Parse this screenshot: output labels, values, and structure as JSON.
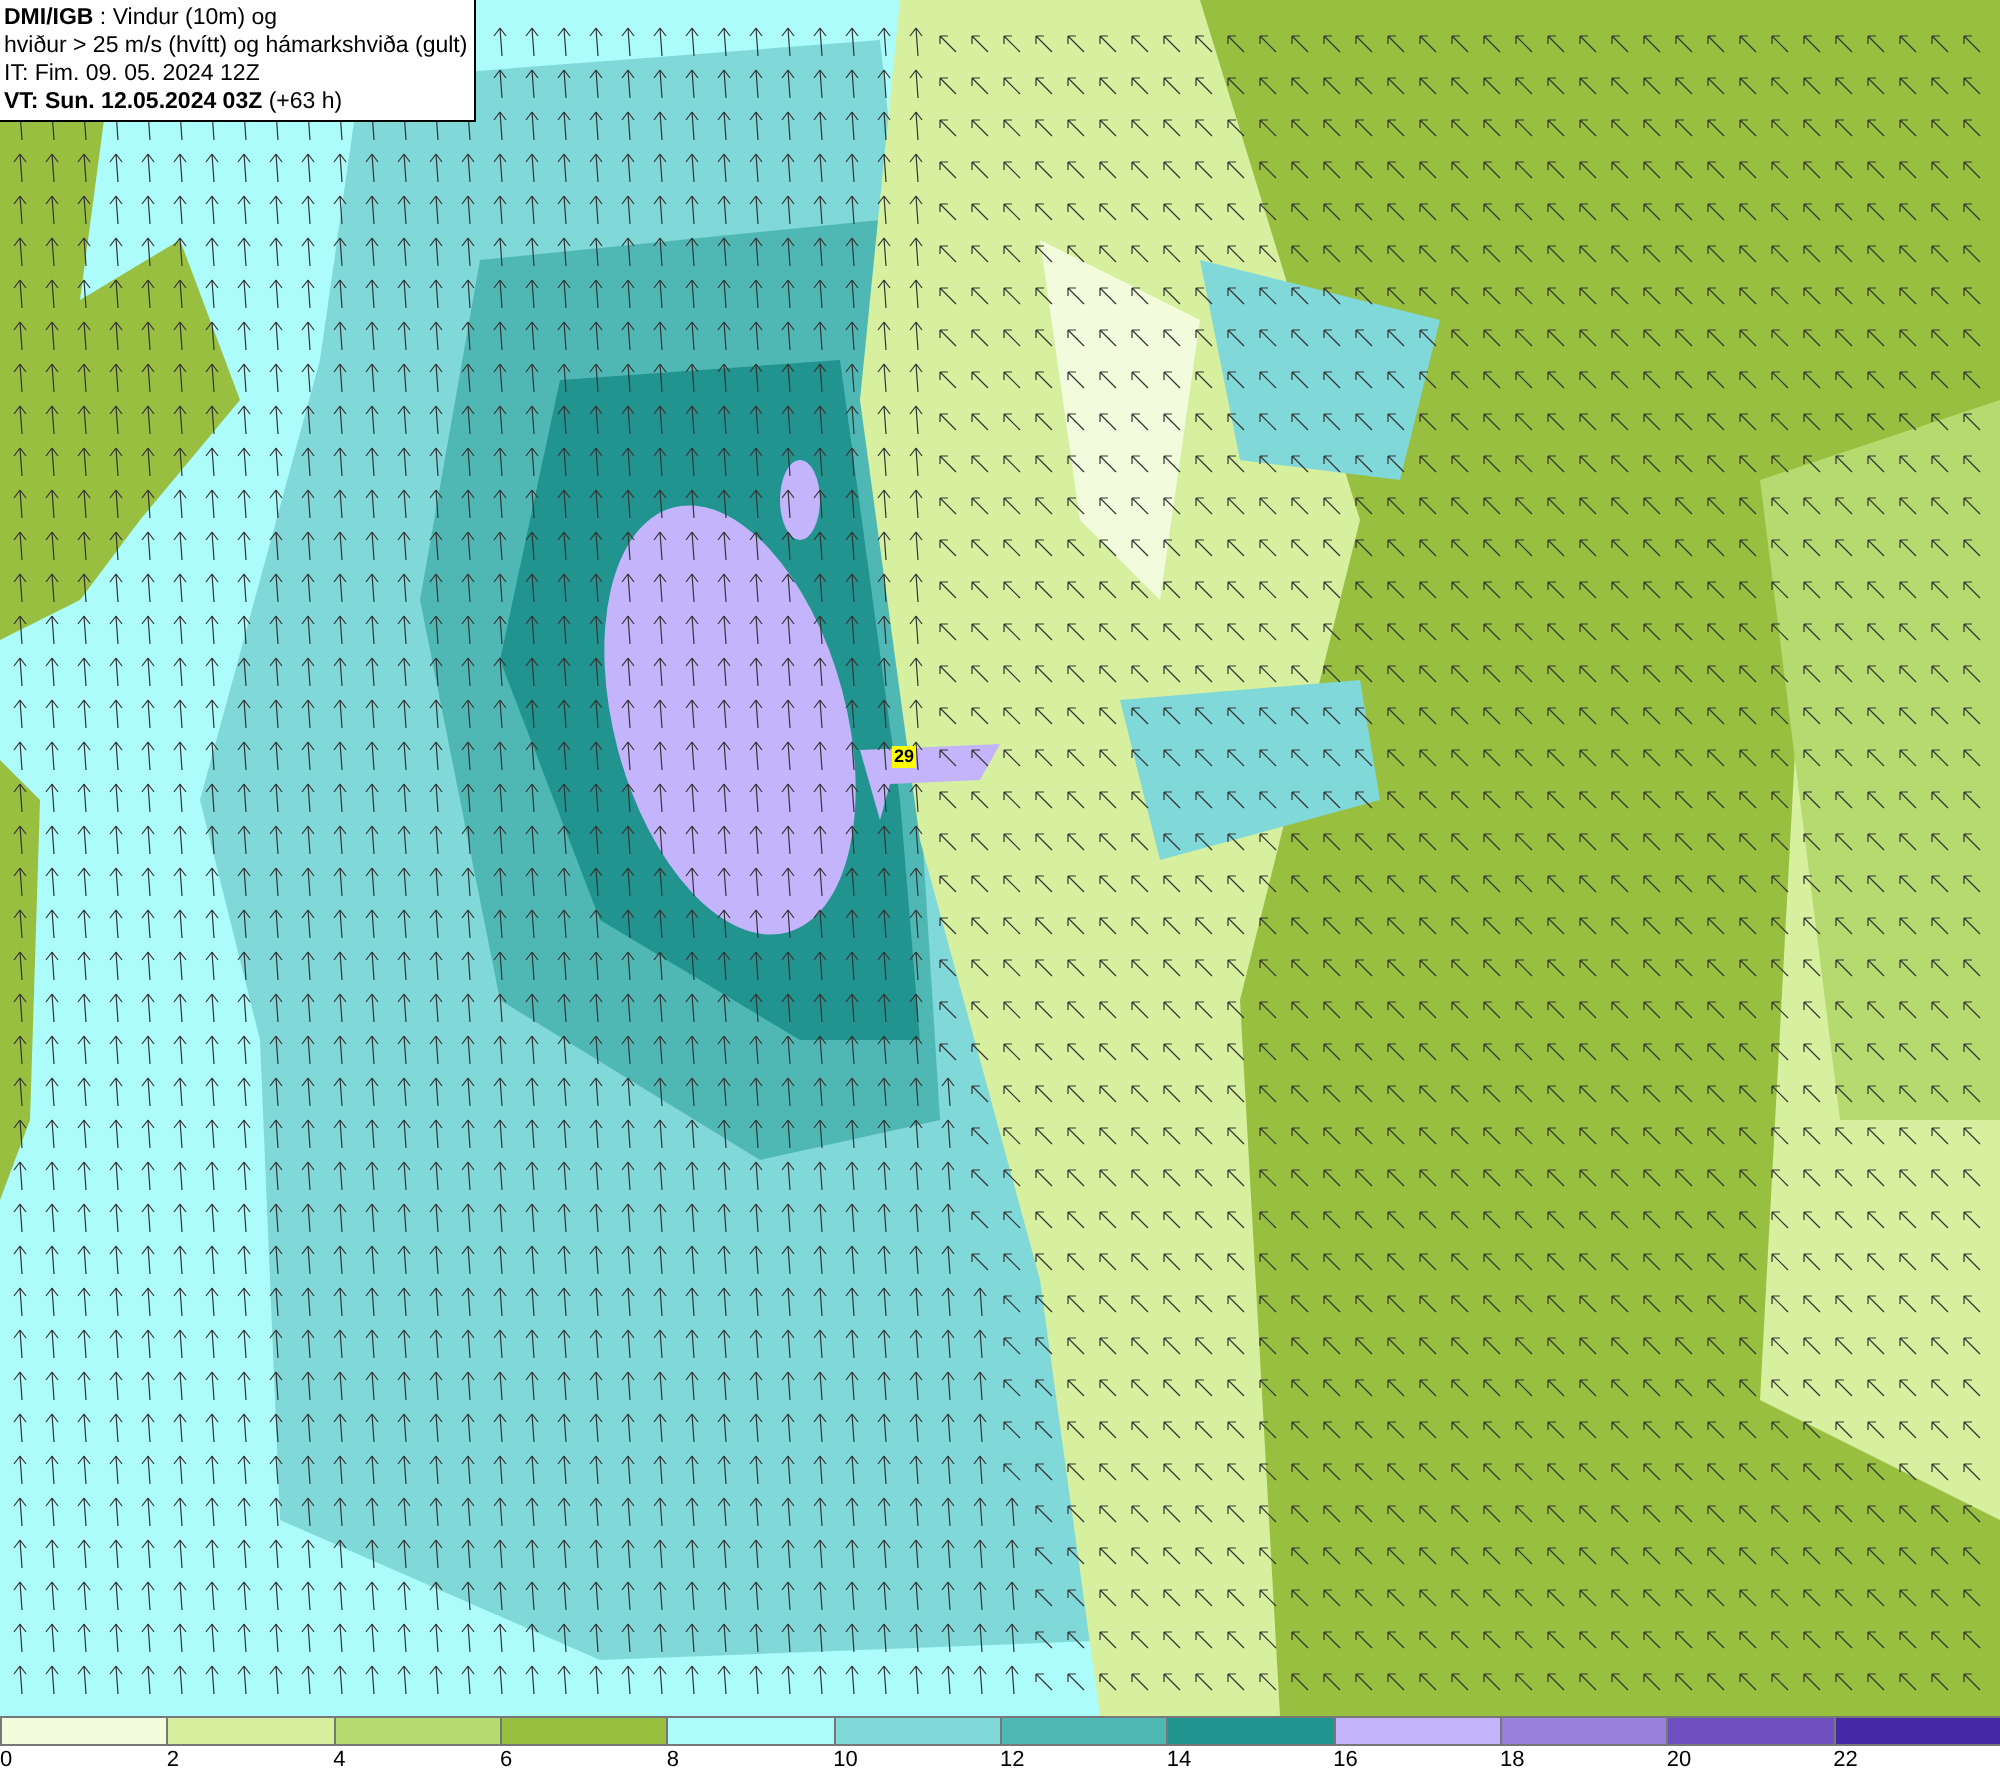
{
  "header": {
    "lines": [
      "**DMI/IGB** : Vindur (10m) og",
      "hviður > 25 m/s (hvítt) og hámarkshviða (gult)",
      "IT: Fim. 09. 05. 2024 12Z",
      "**VT: Sun. 12.05.2024 03Z** (+63 h)"
    ]
  },
  "map": {
    "gust_label": "29"
  },
  "legend": {
    "bins": [
      {
        "label": "0",
        "color": "#f2fcdc"
      },
      {
        "label": "2",
        "color": "#d6f0a0"
      },
      {
        "label": "4",
        "color": "#b6da70"
      },
      {
        "label": "6",
        "color": "#98bf40"
      },
      {
        "label": "8",
        "color": "#adfcfc"
      },
      {
        "label": "10",
        "color": "#80d8d8"
      },
      {
        "label": "12",
        "color": "#50b8b4"
      },
      {
        "label": "14",
        "color": "#229490"
      },
      {
        "label": "16",
        "color": "#c4b4fc"
      },
      {
        "label": "18",
        "color": "#9880dc"
      },
      {
        "label": "20",
        "color": "#7050c0"
      },
      {
        "label": "22",
        "color": "#4428a4"
      }
    ]
  }
}
